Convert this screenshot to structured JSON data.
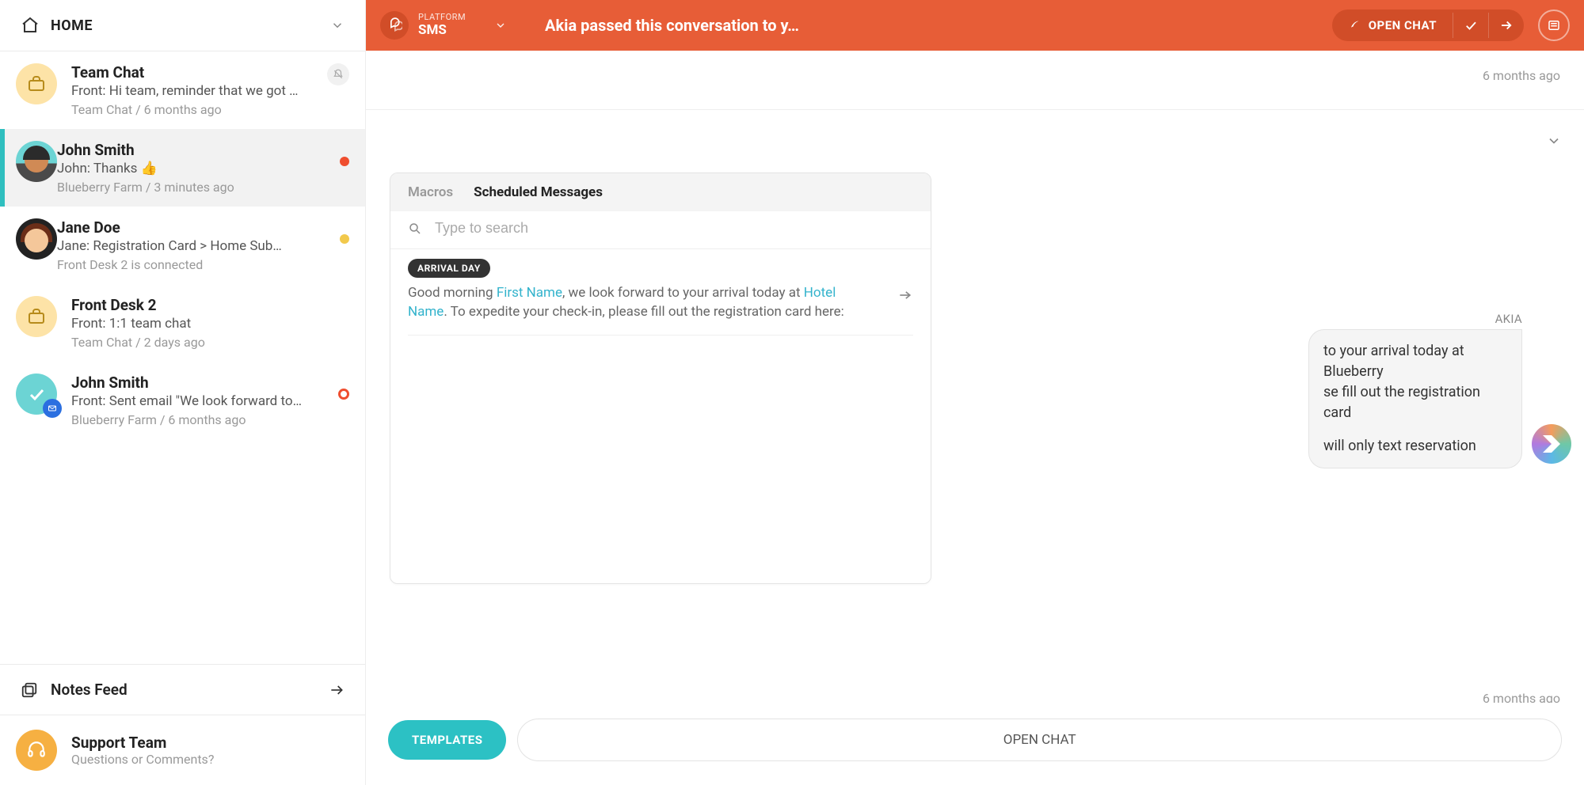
{
  "sidebar": {
    "home_label": "HOME",
    "items": [
      {
        "title": "Team Chat",
        "preview": "Front: Hi team, reminder that we got …",
        "meta": "Team Chat / 6 months ago",
        "avatar_type": "briefcase",
        "muted": true
      },
      {
        "title": "John Smith",
        "preview": "John: Thanks 👍",
        "meta": "Blueberry Farm / 3 minutes ago",
        "avatar_type": "face1",
        "dot": "red",
        "selected": true
      },
      {
        "title": "Jane Doe",
        "preview": "Jane: Registration Card > Home Sub…",
        "meta": "Front Desk 2 is connected",
        "avatar_type": "face2",
        "dot": "yellow"
      },
      {
        "title": "Front Desk 2",
        "preview": "Front: 1:1 team chat",
        "meta": "Team Chat / 2 days ago",
        "avatar_type": "briefcase"
      },
      {
        "title": "John Smith",
        "preview": "Front: Sent email \"We look forward to…",
        "meta": "Blueberry Farm / 6 months ago",
        "avatar_type": "check-mail",
        "ring": true
      }
    ],
    "notes_feed": "Notes Feed",
    "support_title": "Support Team",
    "support_sub": "Questions or Comments?"
  },
  "topbar": {
    "platform_label": "PLATFORM",
    "platform_value": "SMS",
    "title": "Akia passed this conversation to y…",
    "open_chat": "OPEN CHAT"
  },
  "chat": {
    "timestamp_top": "6 months ago",
    "timestamp_bottom": "6 months ago",
    "akia_label": "AKIA",
    "msg_line1": "to your arrival today at Blueberry",
    "msg_line2": "se fill out the registration card",
    "msg_line3": "will only text reservation"
  },
  "popover": {
    "tab_macros": "Macros",
    "tab_scheduled": "Scheduled Messages",
    "search_placeholder": "Type to search",
    "template": {
      "tag": "ARRIVAL DAY",
      "prefix": "Good morning ",
      "var1": "First Name",
      "mid1": ", we look forward to your arrival today at ",
      "var2": "Hotel Name",
      "suffix": ". To expedite your check-in, please fill out the registration card here:"
    }
  },
  "bottom": {
    "templates": "TEMPLATES",
    "open_chat": "OPEN CHAT"
  }
}
